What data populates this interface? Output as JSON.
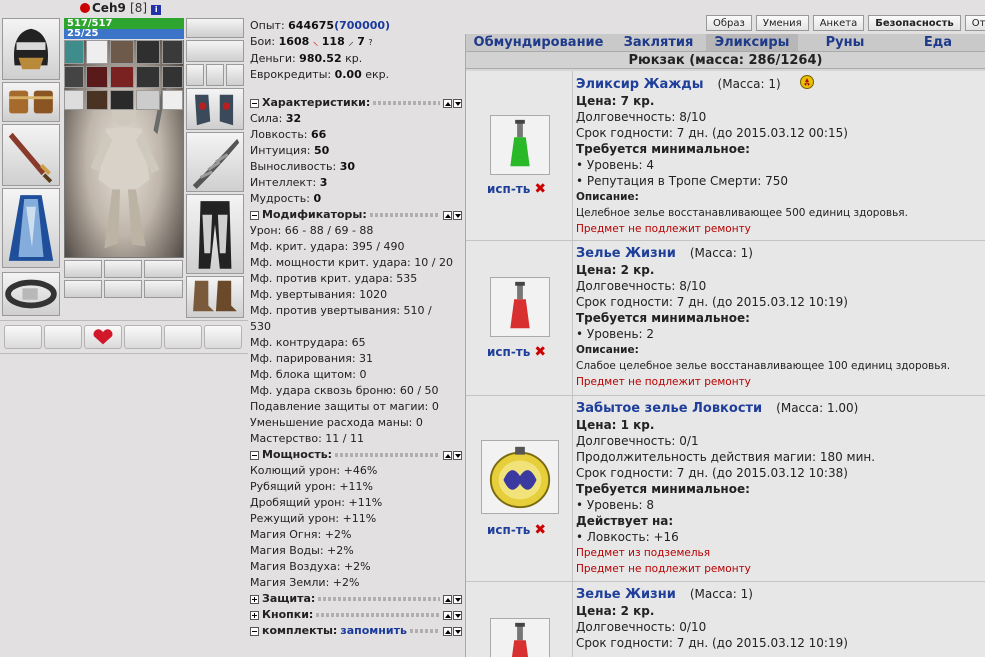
{
  "character": {
    "name": "Ceh9",
    "level": "[8]",
    "info_badge": "i",
    "hp": "517/517",
    "mp": "25/25"
  },
  "stats": {
    "exp_label": "Опыт:",
    "exp_value": "644675",
    "exp_next": "(700000)",
    "battles_label": "Бои:",
    "battles_total": "1608",
    "battles_wins": "118",
    "battles_losses": "7",
    "money_label": "Деньги:",
    "money_value": "980.52",
    "money_unit": "кр.",
    "euro_label": "Еврокредиты:",
    "euro_value": "0.00",
    "euro_unit": "екр.",
    "characteristics_title": "Характеристики:",
    "characteristics": [
      {
        "label": "Сила:",
        "value": "32"
      },
      {
        "label": "Ловкость:",
        "value": "66"
      },
      {
        "label": "Интуиция:",
        "value": "50"
      },
      {
        "label": "Выносливость:",
        "value": "30"
      },
      {
        "label": "Интеллект:",
        "value": "3"
      },
      {
        "label": "Мудрость:",
        "value": "0"
      }
    ],
    "modifiers_title": "Модификаторы:",
    "modifiers": [
      "Урон: 66 - 88 / 69 - 88",
      "Мф. крит. удара: 395 / 490",
      "Мф. мощности крит. удара: 10 / 20",
      "Мф. против крит. удара: 535",
      "Мф. увертывания: 1020",
      "Мф. против увертывания: 510 /",
      "530",
      "Мф. контрудара: 65",
      "Мф. парирования: 31",
      "Мф. блока щитом: 0",
      "Мф. удара сквозь броню: 60 / 50",
      "Подавление защиты от магии: 0",
      "Уменьшение расхода маны: 0",
      "Мастерство: 11 / 11"
    ],
    "power_title": "Мощность:",
    "power": [
      "Колющий урон: +46%",
      "Рубящий урон: +11%",
      "Дробящий урон: +11%",
      "Режущий урон: +11%",
      "Магия Огня: +2%",
      "Магия Воды: +2%",
      "Магия Воздуха: +2%",
      "Магия Земли: +2%"
    ],
    "defense_title": "Защита:",
    "buttons_title": "Кнопки:",
    "sets_title": "комплекты:",
    "sets_remember": "запомнить"
  },
  "top_buttons": [
    "Образ",
    "Умения",
    "Анкета",
    "Безопасность",
    "Отчет"
  ],
  "inventory": {
    "tabs": [
      "Обмундирование",
      "Заклятия",
      "Эликсиры",
      "Руны",
      "Еда"
    ],
    "active_tab": "Эликсиры",
    "bag_title": "Рюкзак (масса: 286/1264)",
    "use_label": "исп-ть",
    "items": [
      {
        "name": "Эликсир Жажды",
        "mass": "(Масса: 1)",
        "price": "Цена: 7 кр.",
        "durability": "Долговечность: 8/10",
        "expiry": "Срок годности: 7 дн. (до 2015.03.12 00:15)",
        "req_title": "Требуется минимальное:",
        "reqs": [
          "• Уровень: 4",
          "• Репутация в Тропе Смерти: 750"
        ],
        "desc_title": "Описание:",
        "desc": "Целебное зелье восстанавливающее 500 единиц здоровья.",
        "note": "Предмет не подлежит ремонту",
        "potion_color": "#28b828"
      },
      {
        "name": "Зелье Жизни",
        "mass": "(Масса: 1)",
        "price": "Цена: 2 кр.",
        "durability": "Долговечность: 8/10",
        "expiry": "Срок годности: 7 дн. (до 2015.03.12 10:19)",
        "req_title": "Требуется минимальное:",
        "reqs": [
          "• Уровень: 2"
        ],
        "desc_title": "Описание:",
        "desc": "Слабое целебное зелье восстанавливающее 100 единиц здоровья.",
        "note": "Предмет не подлежит ремонту",
        "potion_color": "#d83030"
      },
      {
        "name": "Забытое зелье Ловкости",
        "mass": "(Масса: 1.00)",
        "price": "Цена: 1 кр.",
        "durability": "Долговечность: 0/1",
        "duration": "Продолжительность действия магии: 180 мин.",
        "expiry": "Срок годности: 7 дн. (до 2015.03.12 10:38)",
        "req_title": "Требуется минимальное:",
        "reqs": [
          "• Уровень: 8"
        ],
        "acts_title": "Действует на:",
        "acts": [
          "• Ловкость: +16"
        ],
        "note1": "Предмет из подземелья",
        "note": "Предмет не подлежит ремонту"
      },
      {
        "name": "Зелье Жизни",
        "mass": "(Масса: 1)",
        "price": "Цена: 2 кр.",
        "durability": "Долговечность: 0/10",
        "expiry": "Срок годности: 7 дн. (до 2015.03.12 10:19)",
        "potion_color": "#d83030"
      }
    ]
  }
}
